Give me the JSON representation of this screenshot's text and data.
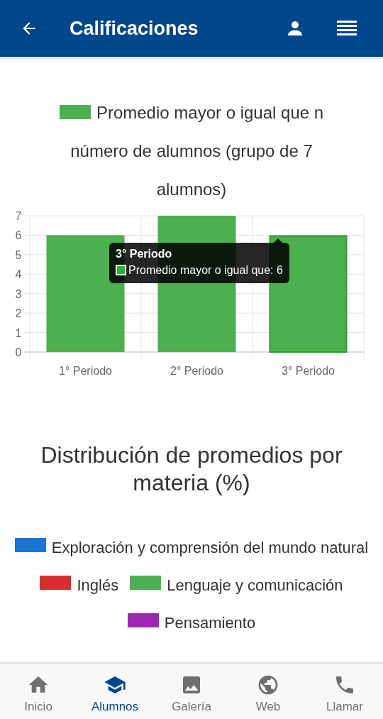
{
  "header": {
    "title": "Calificaciones"
  },
  "chart1": {
    "chart_data": {
      "type": "bar",
      "categories": [
        "1° Periodo",
        "2° Periodo",
        "3° Periodo"
      ],
      "series": [
        {
          "name": "Promedio mayor o igual que n número de alumnos (grupo de 7 alumnos)",
          "color": "#4caf50",
          "values": [
            6,
            7,
            6
          ]
        }
      ],
      "ylim": [
        0,
        7
      ],
      "yticks": [
        0,
        1,
        2,
        3,
        4,
        5,
        6,
        7
      ],
      "grid": true
    },
    "bars": [
      {
        "selected": false
      },
      {
        "selected": false
      },
      {
        "selected": true
      }
    ],
    "tooltip": {
      "title": "3° Periodo",
      "label": "Promedio mayor o igual que: 6"
    }
  },
  "chart2": {
    "title": "Distribución de promedios por materia (%)",
    "legend": [
      {
        "label": "Exploración y comprensión del mundo natural",
        "color": "#1976d2"
      },
      {
        "label": "Inglés",
        "color": "#d32f2f"
      },
      {
        "label": "Lenguaje y comunicación",
        "color": "#4caf50"
      },
      {
        "label": "Pensamiento",
        "color": "#9c27b0"
      }
    ]
  },
  "nav": [
    {
      "label": "Inicio",
      "kind": "home",
      "selected": false
    },
    {
      "label": "Alumnos",
      "kind": "school",
      "selected": true
    },
    {
      "label": "Galería",
      "kind": "image",
      "selected": false
    },
    {
      "label": "Web",
      "kind": "globe",
      "selected": false
    },
    {
      "label": "Llamar",
      "kind": "phone",
      "selected": false
    }
  ]
}
